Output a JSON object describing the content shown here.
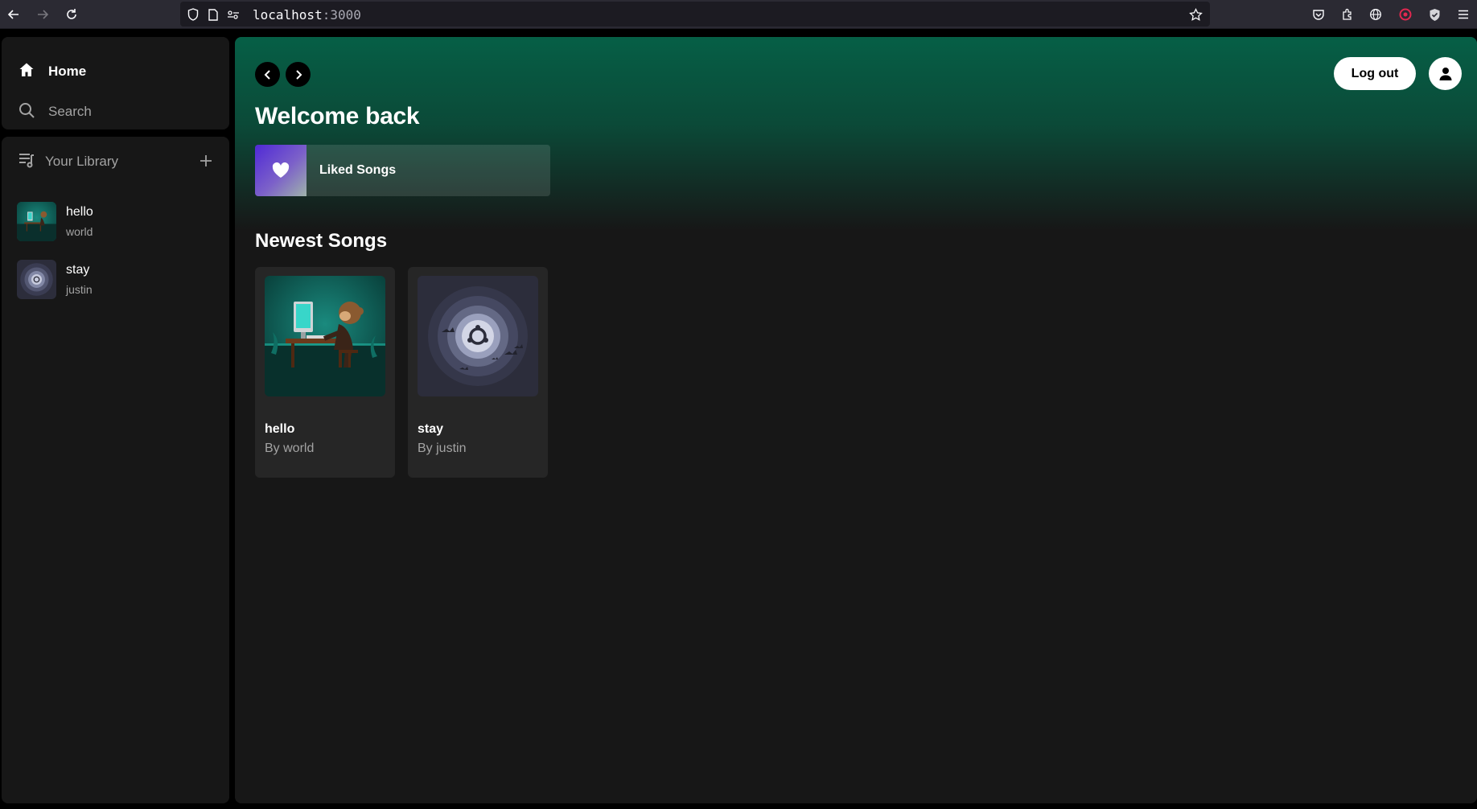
{
  "browser": {
    "url_host": "localhost",
    "url_port": ":3000"
  },
  "sidebar": {
    "nav": [
      {
        "label": "Home",
        "icon": "home-icon"
      },
      {
        "label": "Search",
        "icon": "search-icon"
      }
    ],
    "library": {
      "title": "Your Library",
      "items": [
        {
          "title": "hello",
          "author": "world"
        },
        {
          "title": "stay",
          "author": "justin"
        }
      ]
    }
  },
  "header": {
    "logout_label": "Log out",
    "welcome": "Welcome back",
    "liked_songs_label": "Liked Songs"
  },
  "newest": {
    "title": "Newest Songs",
    "songs": [
      {
        "title": "hello",
        "byline": "By world"
      },
      {
        "title": "stay",
        "byline": "By justin"
      }
    ]
  },
  "colors": {
    "accent_gradient_top": "#065f46",
    "panel": "#171717",
    "card": "#262626",
    "muted_text": "#a3a3a3"
  }
}
